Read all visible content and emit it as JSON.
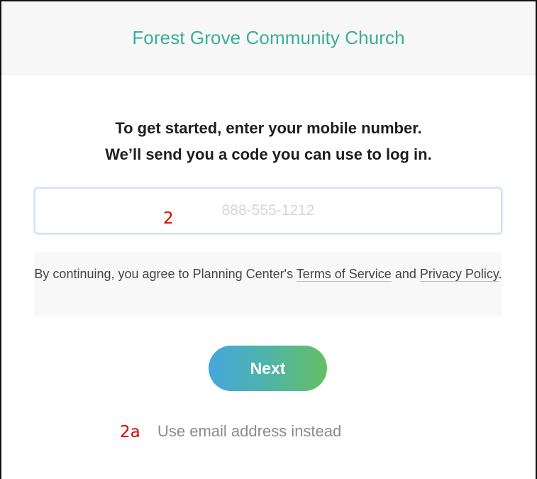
{
  "header": {
    "church_name": "Forest Grove Community Church"
  },
  "instructions": {
    "line1": "To get started, enter your mobile number.",
    "line2": "We’ll send you a code you can use to log in."
  },
  "phone": {
    "value": "",
    "placeholder": "888-555-1212"
  },
  "terms": {
    "prefix": "By continuing, you agree to Planning Center's ",
    "terms_link": "Terms of Service",
    "middle": " and ",
    "privacy_link": "Privacy Policy",
    "suffix": "."
  },
  "next_button": {
    "label": "Next",
    "gradient_colors": [
      "#44a7dd",
      "#66bf64"
    ]
  },
  "alt_login": {
    "label": "Use email address instead"
  },
  "annotations": {
    "phone_marker": "2",
    "email_marker": "2a",
    "color": "#e00000"
  },
  "colors": {
    "brand_green": "#3bae95"
  }
}
